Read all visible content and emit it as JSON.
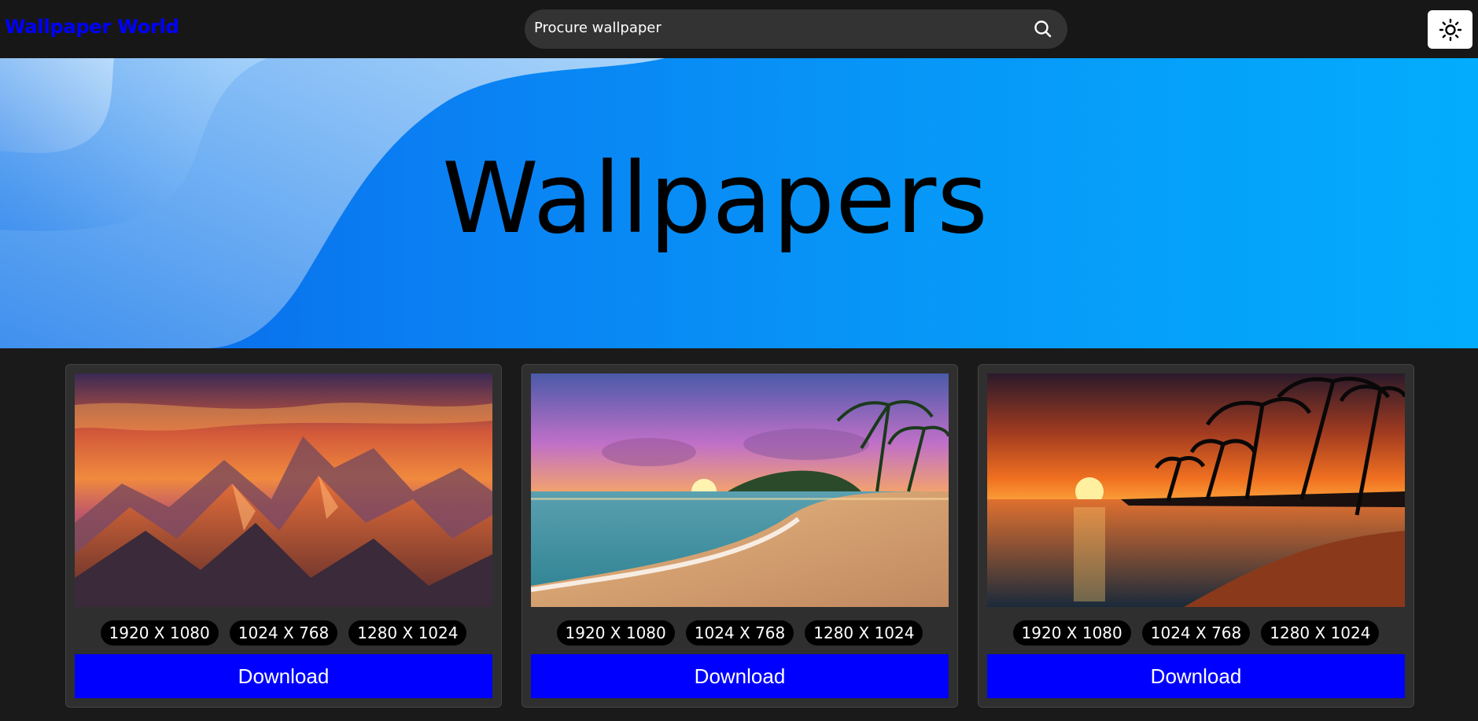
{
  "header": {
    "logo": "Wallpaper World",
    "search_placeholder": "Procure wallpaper",
    "search_icon": "search-icon",
    "theme_icon": "sun-icon"
  },
  "hero": {
    "title": "Wallpapers"
  },
  "colors": {
    "logo": "#0000ff",
    "download_button": "#0000ff",
    "header_bg": "#171717",
    "page_bg": "#1a1a1a",
    "card_bg": "#2f2f2f"
  },
  "cards": [
    {
      "image": "mountain sunset wallpaper",
      "resolutions": [
        "1920 X 1080",
        "1024 X 768",
        "1280 X 1024"
      ],
      "download_label": "Download"
    },
    {
      "image": "tropical beach sunrise wallpaper",
      "resolutions": [
        "1920 X 1080",
        "1024 X 768",
        "1280 X 1024"
      ],
      "download_label": "Download"
    },
    {
      "image": "palm beach sunset wallpaper",
      "resolutions": [
        "1920 X 1080",
        "1024 X 768",
        "1280 X 1024"
      ],
      "download_label": "Download"
    }
  ]
}
